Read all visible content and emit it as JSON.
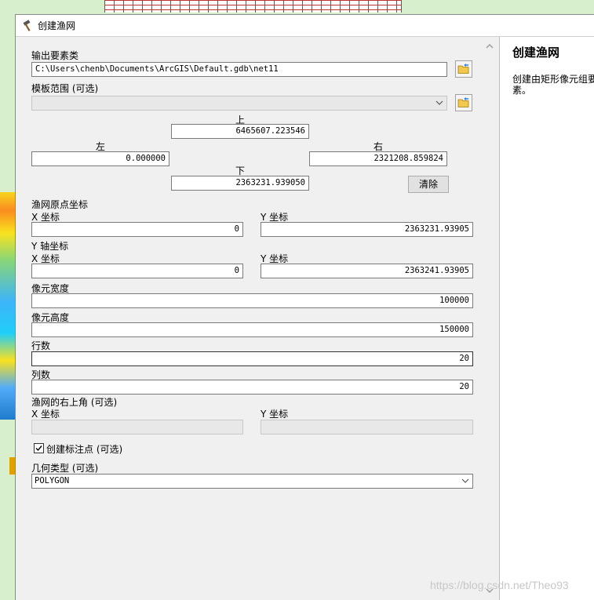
{
  "window": {
    "title": "创建渔网"
  },
  "output_feature_class": {
    "label": "输出要素类",
    "value": "C:\\Users\\chenb\\Documents\\ArcGIS\\Default.gdb\\net11"
  },
  "template_extent": {
    "label": "模板范围 (可选)",
    "value": "",
    "top_label": "上",
    "top_value": "6465607.223546",
    "left_label": "左",
    "left_value": "0.000000",
    "right_label": "右",
    "right_value": "2321208.859824",
    "bottom_label": "下",
    "bottom_value": "2363231.939050",
    "clear_label": "清除"
  },
  "origin": {
    "label": "渔网原点坐标",
    "x_label": "X 坐标",
    "x_value": "0",
    "y_label": "Y 坐标",
    "y_value": "2363231.93905"
  },
  "y_axis": {
    "label": "Y 轴坐标",
    "x_label": "X 坐标",
    "x_value": "0",
    "y_label": "Y 坐标",
    "y_value": "2363241.93905"
  },
  "cell_width": {
    "label": "像元宽度",
    "value": "100000"
  },
  "cell_height": {
    "label": "像元高度",
    "value": "150000"
  },
  "rows": {
    "label": "行数",
    "value": "20"
  },
  "columns": {
    "label": "列数",
    "value": "20"
  },
  "opposite_corner": {
    "label": "渔网的右上角 (可选)",
    "x_label": "X 坐标",
    "x_value": "",
    "y_label": "Y 坐标",
    "y_value": ""
  },
  "create_labels": {
    "label": "创建标注点 (可选)",
    "checked": true
  },
  "geometry_type": {
    "label": "几何类型 (可选)",
    "value": "POLYGON"
  },
  "help": {
    "title": "创建渔网",
    "text": "创建由矩形像元组成的网格要素。",
    "text_visible": "创建由矩形像元组要素。"
  },
  "watermark": "https://blog.csdn.net/Theo93",
  "icons": {
    "title": "hammer-icon",
    "browse": "folder-icon",
    "dropdown": "chevron-down-icon"
  }
}
